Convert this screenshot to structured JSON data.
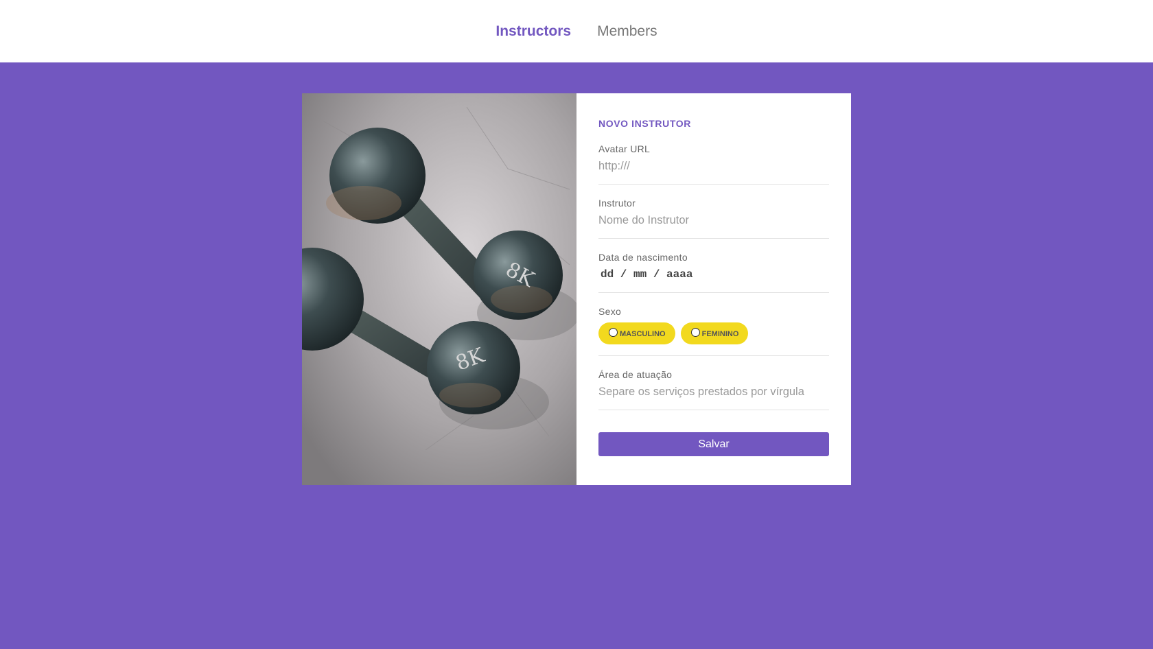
{
  "nav": {
    "items": [
      {
        "label": "Instructors",
        "active": true
      },
      {
        "label": "Members",
        "active": false
      }
    ]
  },
  "form": {
    "title": "NOVO INSTRUTOR",
    "avatar": {
      "label": "Avatar URL",
      "placeholder": "http:///",
      "value": ""
    },
    "instructor": {
      "label": "Instrutor",
      "placeholder": "Nome do Instrutor",
      "value": ""
    },
    "birth": {
      "label": "Data de nascimento",
      "placeholder": "dd / mm / aaaa"
    },
    "gender": {
      "label": "Sexo",
      "options": [
        {
          "label": "MASCULINO",
          "checked": false
        },
        {
          "label": "FEMININO",
          "checked": false
        }
      ]
    },
    "services": {
      "label": "Área de atuação",
      "placeholder": "Separe os serviços prestados por vírgula",
      "value": ""
    },
    "save_label": "Salvar"
  },
  "hero_image": {
    "alt_icon": "dumbbells-photo",
    "weight_marks": [
      "8K",
      "8K"
    ]
  },
  "colors": {
    "brand": "#7257c0",
    "accent": "#f2d91e",
    "background": "#ffffff"
  }
}
